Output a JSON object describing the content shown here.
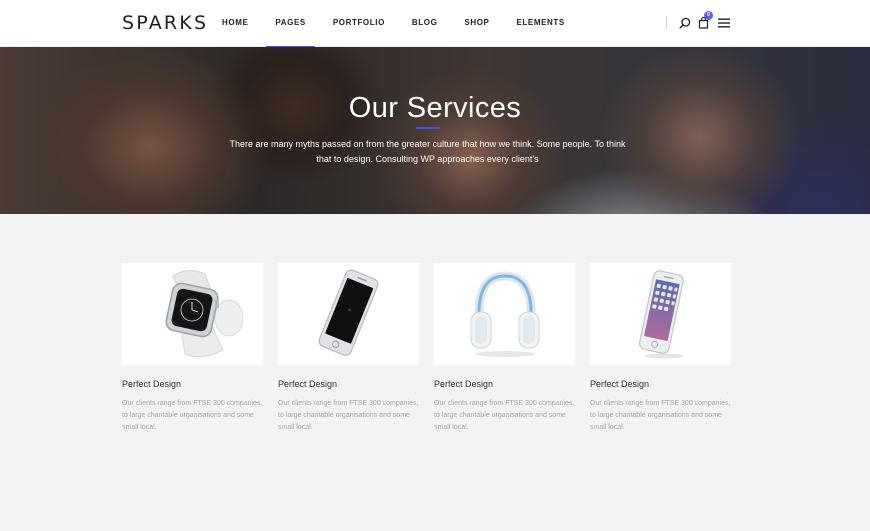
{
  "brand": {
    "logo": "SPARKS"
  },
  "nav": {
    "items": [
      {
        "label": "HOME"
      },
      {
        "label": "PAGES",
        "active": true
      },
      {
        "label": "PORTFOLIO"
      },
      {
        "label": "BLOG"
      },
      {
        "label": "SHOP"
      },
      {
        "label": "ELEMENTS"
      }
    ],
    "icons": [
      "search-icon",
      "cart-icon",
      "menu-icon"
    ],
    "cart_count": "0"
  },
  "hero": {
    "title": "Our Services",
    "subtitle": "There are many myths passed on from the greater culture that how we think. Some people. To think that to design. Consulting WP approaches every client's"
  },
  "services": [
    {
      "title": "Perfect Design",
      "text": "Our clients range from FTSE 300 companies, to large charitable organisations and some small local.",
      "image": "smartwatch"
    },
    {
      "title": "Perfect Design",
      "text": "Our clients range from FTSE 300 companies, to large charitable organisations and some small local.",
      "image": "smartphone-dark"
    },
    {
      "title": "Perfect Design",
      "text": "Our clients range from FTSE 300 companies, to large charitable organisations and some small local.",
      "image": "headphones"
    },
    {
      "title": "Perfect Design",
      "text": "Our clients range from FTSE 300 companies, to large charitable organisations and some small local.",
      "image": "smartphone-silver"
    }
  ],
  "colors": {
    "accent": "#4a52e6",
    "page_bg": "#f3f3f3",
    "text": "#222222",
    "muted": "#a6a6a6"
  }
}
